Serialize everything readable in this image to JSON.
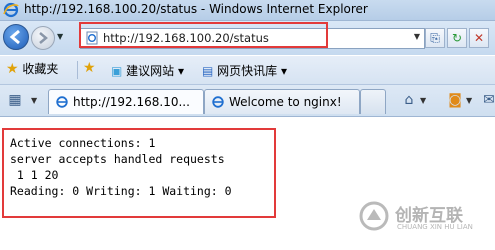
{
  "window": {
    "title": "http://192.168.100.20/status - Windows Internet Explorer"
  },
  "address_bar": {
    "url": "http://192.168.100.20/status"
  },
  "favorites_bar": {
    "favorites_label": "收藏夹",
    "items": [
      "建议网站 ▾",
      "网页快讯库 ▾"
    ]
  },
  "tabs": [
    {
      "label": "http://192.168.10...",
      "active": true
    },
    {
      "label": "Welcome to nginx!",
      "active": false
    }
  ],
  "page": {
    "lines": [
      "Active connections: 1",
      "server accepts handled requests",
      " 1 1 20",
      "Reading: 0 Writing: 1 Waiting: 0"
    ]
  },
  "watermark": {
    "cn": "创新互联",
    "en": "CHUANG XIN HU LIAN"
  },
  "colors": {
    "highlight": "#e23a3a",
    "chrome": "#c5d9ef"
  }
}
